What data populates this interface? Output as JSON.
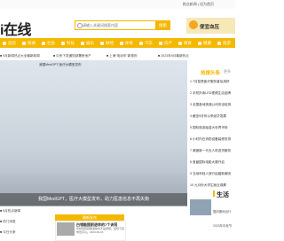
{
  "topbar": {
    "right_text": "热点新闻 | 设为首页"
  },
  "header": {
    "logo": "i在线",
    "search_placeholder": "请输入关键词搜索内容",
    "search_button": "搜索",
    "promo": "便宜血压"
  },
  "nav": [
    "首页",
    "新闻",
    "社会",
    "科技",
    "娱乐",
    "财经",
    "体育",
    "汽车",
    "房产",
    "教育",
    "健康",
    "旅游"
  ],
  "ticker": [
    "■ 9月新闻热点大全最新新闻",
    "■ 中央下发通知部署房地产",
    "■ 上海\"电动车\"新规则",
    "■ 2023年9月最新热点"
  ],
  "hero": {
    "top_caption": "我国MedGPT 医疗大模型发布",
    "caption": "我国MedGPT，医疗大模型发布，助力医患信息不再失衡"
  },
  "hot": {
    "label": "热搜头条",
    "more": "更多",
    "items": [
      "1 7月智慧医疗服务普及用好",
      "2 手机外卖LED视频生活品牌",
      "3 全国各地快递公司安全检测",
      "4 截至9月份以来经济发展",
      "5 国际旅游疫苗大世界市场",
      "6 小时内在消防设备装修安排",
      "7 美团新一代无人机送货服务",
      "8 首届国际电影大赛开启",
      "9 当地年轻人旅行结婚新潮流",
      "10 九月份大学生就业观察"
    ]
  },
  "left_items": [
    "■ 9月热点新闻",
    "■ 热门消息",
    "■ 今日头条"
  ],
  "featured": {
    "bar": "最新发布",
    "title": "白领能提前退休的7个诀窍",
    "desc": "年纪轻轻就能退休并不是梦想。坚持下来你也可以。2023-09-15"
  },
  "life": {
    "title": "生活",
    "items": [
      "国庆期间出行",
      "2023年中秋节"
    ]
  }
}
